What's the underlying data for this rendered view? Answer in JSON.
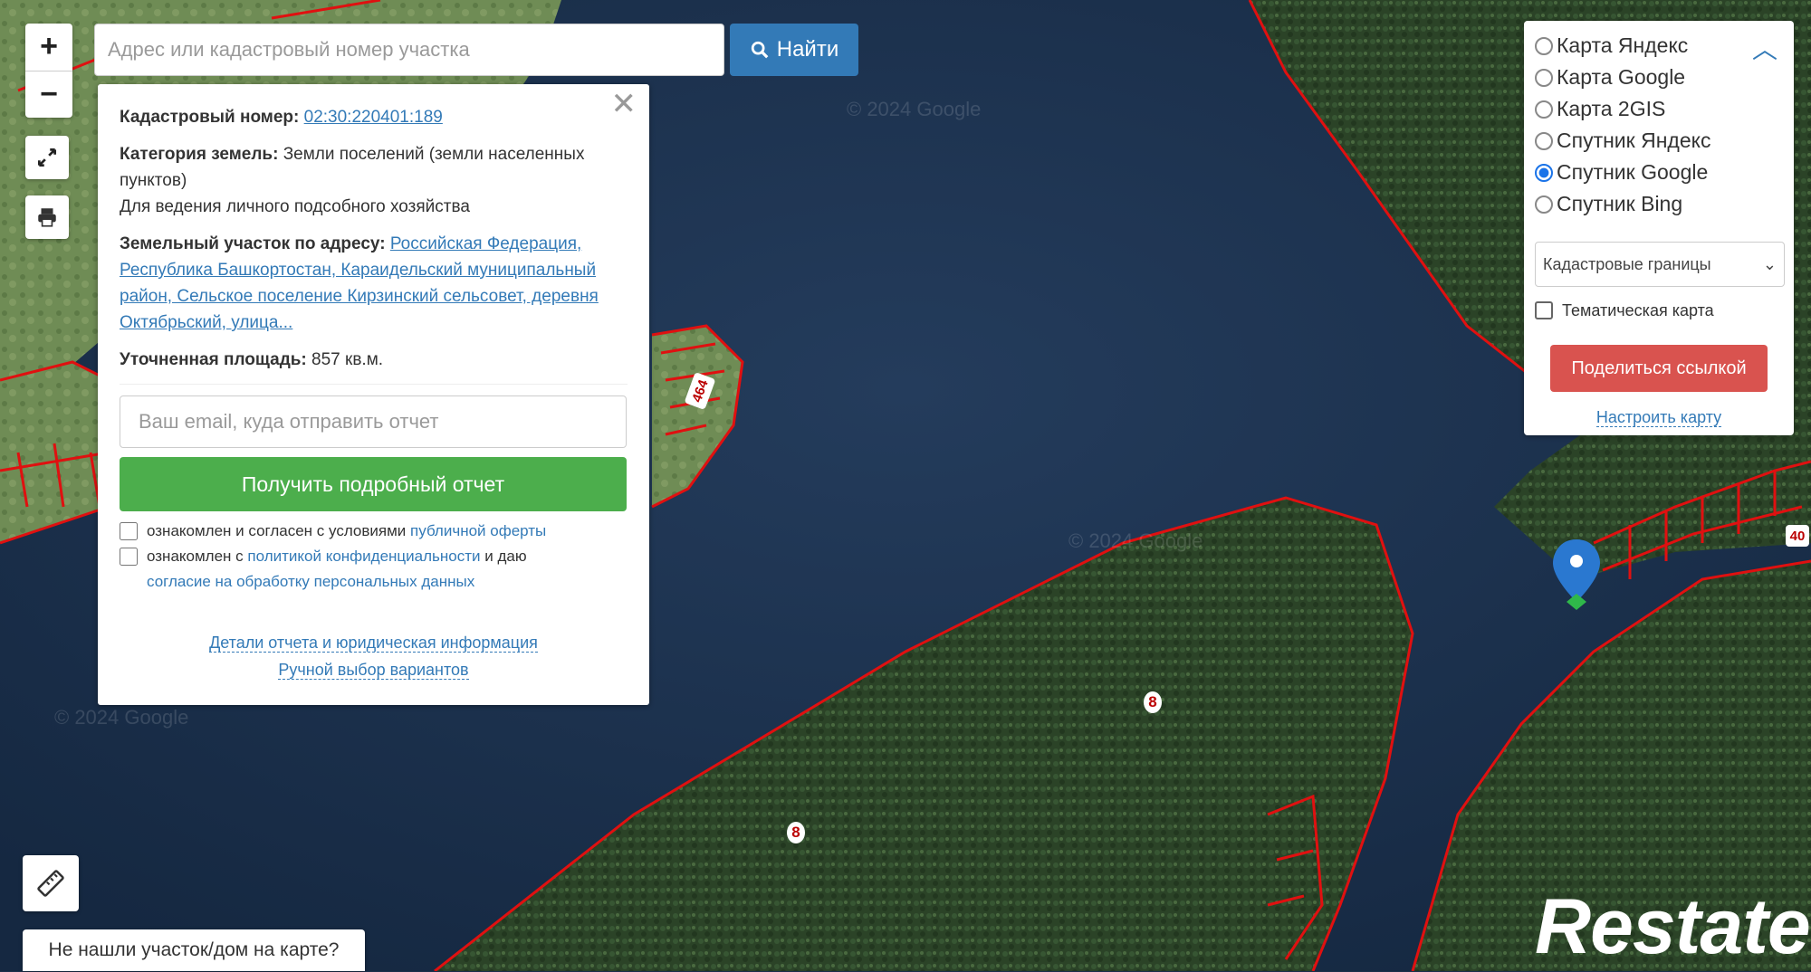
{
  "map": {
    "zoom_in": "+",
    "zoom_out": "−",
    "fullscreen_icon": "expand-icon",
    "print_icon": "printer-icon",
    "watermark": "© 2024 Google",
    "parcel_labels": [
      "8",
      "8",
      "464",
      "40"
    ]
  },
  "search": {
    "placeholder": "Адрес или кадастровый номер участка",
    "button": "Найти"
  },
  "info": {
    "cadastral_label": "Кадастровый номер:",
    "cadastral_value": "02:30:220401:189",
    "category_label": "Категория земель:",
    "category_value": "Земли поселений (земли населенных пунктов)",
    "usage": "Для ведения личного подсобного хозяйства",
    "address_label": "Земельный участок по адресу:",
    "address_value": "Российская Федерация, Республика Башкортостан, Караидельский муниципальный район, Сельское поселение Кирзинский сельсовет, деревня Октябрьский, улица...",
    "area_label": "Уточненная площадь:",
    "area_value": "857 кв.м.",
    "email_placeholder": "Ваш email, куда отправить отчет",
    "report_button": "Получить подробный отчет",
    "agree1_text": "ознакомлен и согласен с условиями",
    "agree1_link": "публичной оферты",
    "agree2_text": "ознакомлен с",
    "agree2_link": "политикой конфиденциальности",
    "agree2_mid": "и даю",
    "agree2_link2": "согласие на обработку персональных данных",
    "details_link": "Детали отчета и юридическая информация",
    "manual_link": "Ручной выбор вариантов"
  },
  "layers": {
    "options": [
      {
        "label": "Карта Яндекс",
        "selected": false
      },
      {
        "label": "Карта Google",
        "selected": false
      },
      {
        "label": "Карта 2GIS",
        "selected": false
      },
      {
        "label": "Спутник Яндекс",
        "selected": false
      },
      {
        "label": "Спутник Google",
        "selected": true
      },
      {
        "label": "Спутник Bing",
        "selected": false
      }
    ],
    "select_value": "Кадастровые границы",
    "thematic_label": "Тематическая карта",
    "share_button": "Поделиться ссылкой",
    "configure_link": "Настроить карту"
  },
  "bottom": {
    "not_found": "Не нашли участок/дом на карте?",
    "brand": "Restate"
  },
  "colors": {
    "water": "#1b2f4a",
    "forest": "#2f4a2a",
    "boundary": "#e01010",
    "primary": "#337ab7",
    "success": "#4cae4c",
    "danger": "#d9534f"
  }
}
